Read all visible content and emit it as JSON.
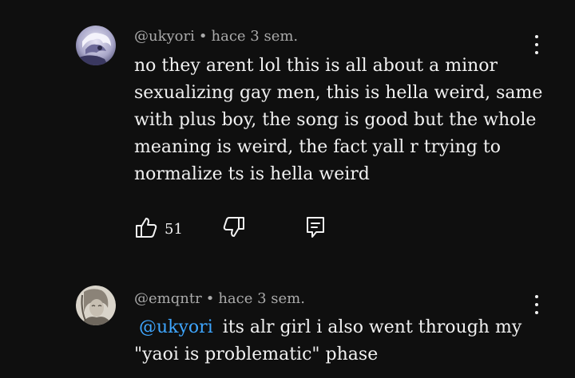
{
  "comments": [
    {
      "author": "@ukyori",
      "separator": "•",
      "time": "hace 3 sem.",
      "text": "no they arent lol this is all about a minor sexualizing gay men, this is hella weird, same with plus boy, the song is good but the whole meaning is weird, the fact yall r trying to normalize ts is hella weird",
      "likes": "51",
      "icons": {
        "like": "thumbs-up-icon",
        "dislike": "thumbs-down-icon",
        "reply": "reply-icon",
        "menu": "more-vertical-icon"
      }
    },
    {
      "author": "@emqntr",
      "separator": "•",
      "time": "hace 3 sem.",
      "mention": "@ukyori",
      "text": "its alr girl i also went through my \"yaoi is problematic\" phase"
    }
  ],
  "colors": {
    "background": "#0f0f0f",
    "text": "#f1f1f1",
    "meta": "#aaaaaa",
    "mention": "#3ea6ff"
  }
}
